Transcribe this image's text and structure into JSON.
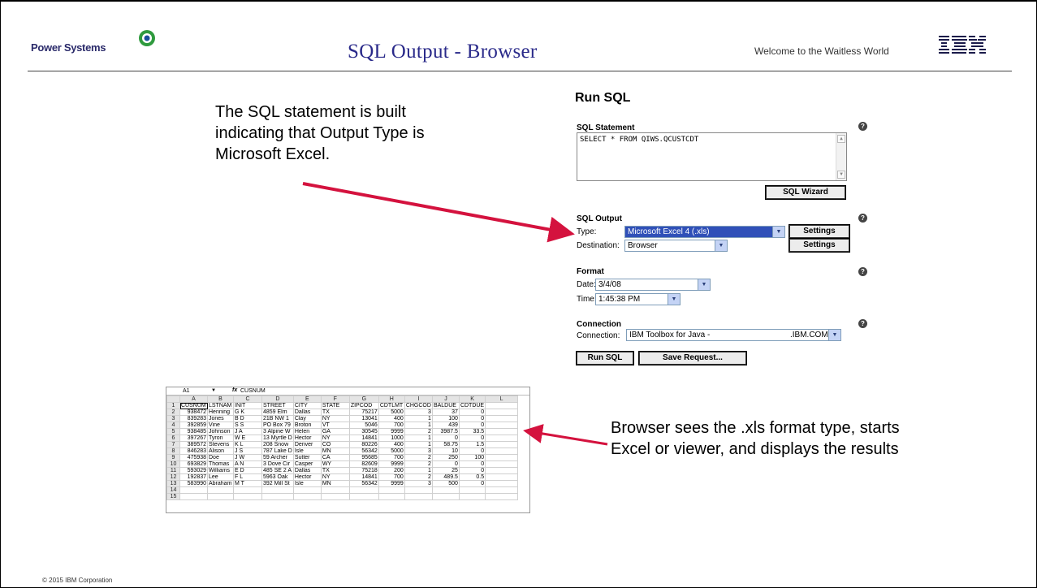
{
  "header": {
    "brand": "Power Systems",
    "title": "SQL Output - Browser",
    "welcome": "Welcome to the Waitless World",
    "ibm_logo": "IBM"
  },
  "callouts": {
    "left": "The SQL statement is built indicating that  Output Type is Microsoft Excel.",
    "right": "Browser sees the .xls format type, starts  Excel or viewer, and displays the results"
  },
  "run_sql": {
    "title": "Run SQL",
    "statement_label": "SQL Statement",
    "statement_value": "SELECT * FROM QIWS.QCUSTCDT",
    "wizard_button": "SQL Wizard",
    "output_label": "SQL Output",
    "type_label": "Type:",
    "type_value": "Microsoft Excel 4 (.xls)",
    "destination_label": "Destination:",
    "destination_value": "Browser",
    "settings_button": "Settings",
    "format_label": "Format",
    "date_label": "Date:",
    "date_value": "3/4/08",
    "time_label": "Time:",
    "time_value": "1:45:38 PM",
    "connection_section": "Connection",
    "connection_label": "Connection:",
    "connection_value": "IBM Toolbox for Java -",
    "connection_suffix": ".IBM.COM",
    "run_button": "Run SQL",
    "save_button": "Save Request..."
  },
  "spreadsheet": {
    "name_box": "A1",
    "fx": "fx",
    "formula": "CUSNUM",
    "col_headers": [
      "A",
      "B",
      "C",
      "D",
      "E",
      "F",
      "G",
      "H",
      "I",
      "J",
      "K",
      "L"
    ],
    "rows": [
      [
        "CUSNUM",
        "LSTNAM",
        "INIT",
        "STREET",
        "CITY",
        "STATE",
        "ZIPCOD",
        "CDTLMT",
        "CHGCOD",
        "BALDUE",
        "CDTDUE",
        ""
      ],
      [
        "938472",
        "Henning",
        "G K",
        "4859 Elm",
        "Dallas",
        "TX",
        "75217",
        "5000",
        "3",
        "37",
        "0",
        ""
      ],
      [
        "839283",
        "Jones",
        "B D",
        "21B NW 1",
        "Clay",
        "NY",
        "13041",
        "400",
        "1",
        "100",
        "0",
        ""
      ],
      [
        "392859",
        "Vine",
        "S S",
        "PO Box 79",
        "Broton",
        "VT",
        "5046",
        "700",
        "1",
        "439",
        "0",
        ""
      ],
      [
        "938485",
        "Johnson",
        "J A",
        "3 Alpine W",
        "Helen",
        "GA",
        "30545",
        "9999",
        "2",
        "3987.5",
        "33.5",
        ""
      ],
      [
        "397267",
        "Tyron",
        "W E",
        "13 Myrtle D",
        "Hector",
        "NY",
        "14841",
        "1000",
        "1",
        "0",
        "0",
        ""
      ],
      [
        "389572",
        "Stevens",
        "K L",
        "208 Snow",
        "Denver",
        "CO",
        "80226",
        "400",
        "1",
        "58.75",
        "1.5",
        ""
      ],
      [
        "846283",
        "Alison",
        "J S",
        "787 Lake D",
        "Isle",
        "MN",
        "56342",
        "5000",
        "3",
        "10",
        "0",
        ""
      ],
      [
        "475938",
        "Doe",
        "J W",
        "59 Archer",
        "Sutter",
        "CA",
        "95685",
        "700",
        "2",
        "250",
        "100",
        ""
      ],
      [
        "693829",
        "Thomas",
        "A N",
        "3 Dove Cir",
        "Casper",
        "WY",
        "82609",
        "9999",
        "2",
        "0",
        "0",
        ""
      ],
      [
        "593029",
        "Williams",
        "E D",
        "485 SE 2 A",
        "Dallas",
        "TX",
        "75218",
        "200",
        "1",
        "25",
        "0",
        ""
      ],
      [
        "192837",
        "Lee",
        "F L",
        "5963 Oak",
        "Hector",
        "NY",
        "14841",
        "700",
        "2",
        "489.5",
        "0.5",
        ""
      ],
      [
        "583990",
        "Abraham",
        "M T",
        "392 Mill St",
        "Isle",
        "MN",
        "56342",
        "9999",
        "3",
        "500",
        "0",
        ""
      ],
      [
        "",
        "",
        "",
        "",
        "",
        "",
        "",
        "",
        "",
        "",
        "",
        ""
      ],
      [
        "",
        "",
        "",
        "",
        "",
        "",
        "",
        "",
        "",
        "",
        "",
        ""
      ]
    ]
  },
  "footer": {
    "copyright": "© 2015 IBM Corporation"
  },
  "colors": {
    "title": "#2a2a8a",
    "arrow": "#d4123e",
    "select_highlight": "#3050b8"
  }
}
